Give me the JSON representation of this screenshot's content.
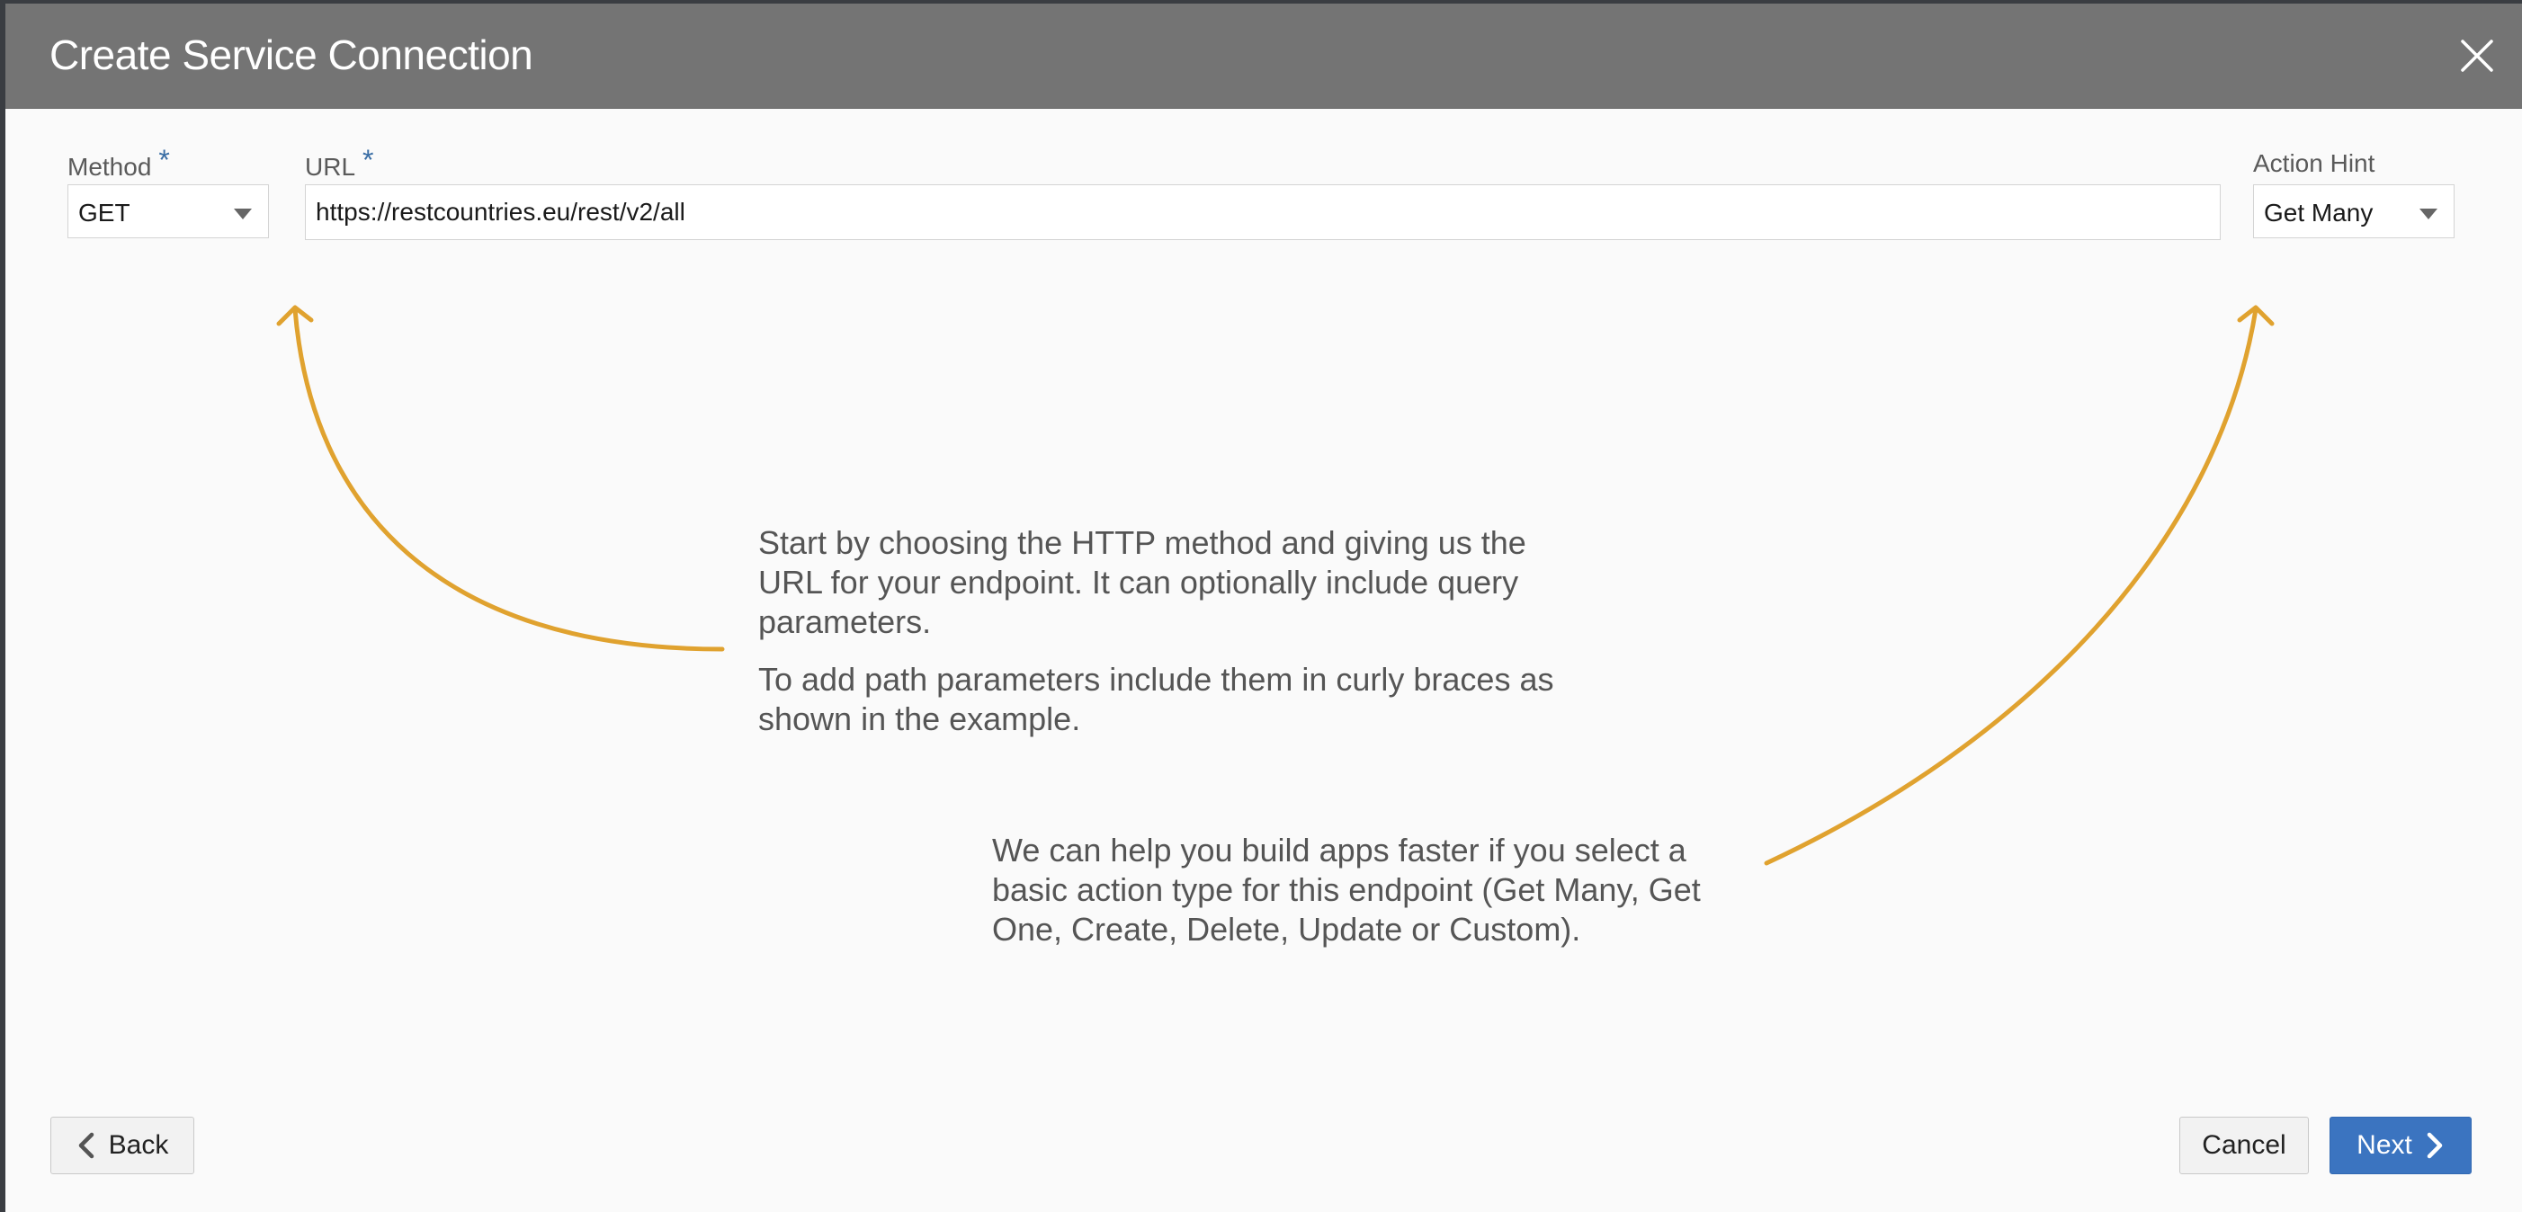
{
  "dialog": {
    "title": "Create Service Connection"
  },
  "form": {
    "method": {
      "label": "Method",
      "required": "*",
      "value": "GET"
    },
    "url": {
      "label": "URL",
      "required": "*",
      "value": "https://restcountries.eu/rest/v2/all"
    },
    "action_hint": {
      "label": "Action Hint",
      "value": "Get Many"
    }
  },
  "hints": {
    "url_hint_p1": "Start by choosing the HTTP method and giving us the URL for your endpoint. It can optionally include query parameters.",
    "url_hint_p2": "To add path parameters include them in curly braces as shown in the example.",
    "action_hint": "We can help you build apps faster if you select a basic action type for this endpoint (Get Many, Get One, Create, Delete, Update or Custom)."
  },
  "footer": {
    "back_label": "Back",
    "cancel_label": "Cancel",
    "next_label": "Next"
  },
  "colors": {
    "titlebar": "#747474",
    "accent": "#3b74c0",
    "arrow": "#e0a22f",
    "required": "#3a6ea5"
  },
  "icons": {
    "close": "close-icon",
    "back": "chevron-left-icon",
    "next": "chevron-right-icon",
    "dropdown": "caret-down-icon"
  }
}
